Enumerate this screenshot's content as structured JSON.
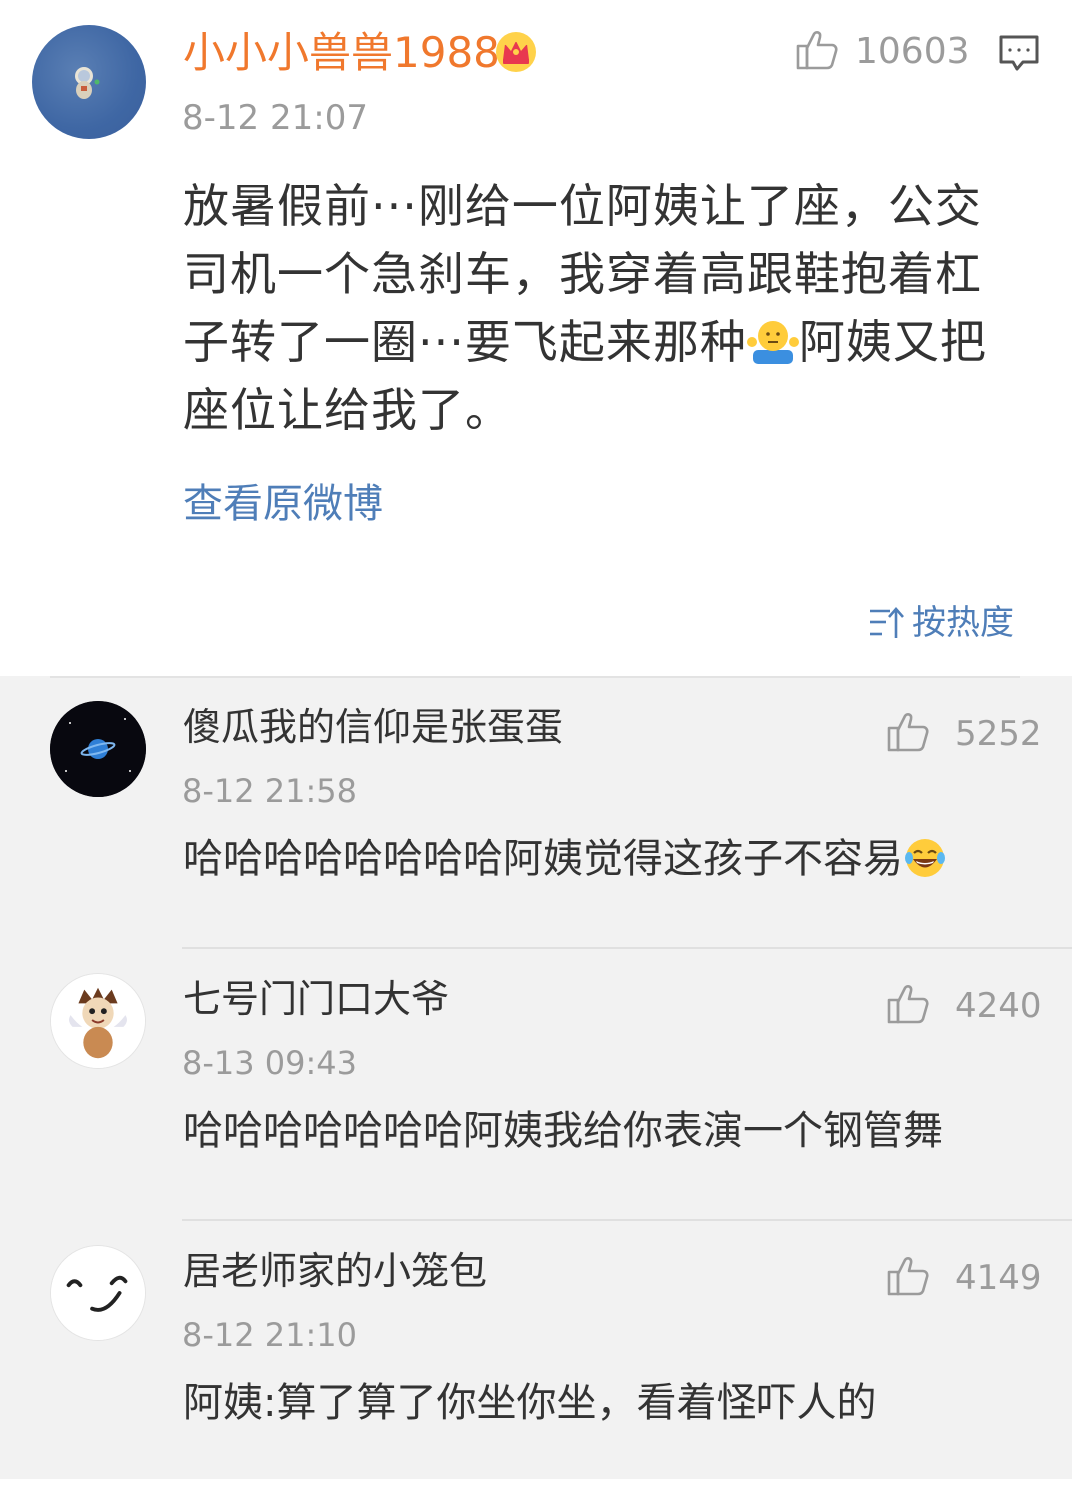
{
  "colors": {
    "username_orange": "#f0782d",
    "link_blue": "#4f7eb8",
    "meta_gray": "#9b9b9b",
    "body_text": "#333333",
    "replies_background": "#f2f2f2"
  },
  "main_comment": {
    "username": "小小小兽兽1988",
    "badge_icon": "crown-badge-icon",
    "time": "8-12 21:07",
    "like_count": "10603",
    "like_icon": "thumbs-up-icon",
    "comment_icon": "comment-bubble-icon",
    "text_before_emoji": "放暑假前···刚给一位阿姨让了座，公交司机一个急刹车，我穿着高跟鞋抱着杠子转了一圈···要飞起来那种",
    "emoji": "shrug-emoji-icon",
    "text_after_emoji": "阿姨又把座位让给我了。",
    "view_original_label": "查看原微博"
  },
  "sort": {
    "icon": "sort-icon",
    "label": "按热度"
  },
  "replies": [
    {
      "username": "傻瓜我的信仰是张蛋蛋",
      "time": "8-12 21:58",
      "like_count": "5252",
      "text": "哈哈哈哈哈哈哈哈阿姨觉得这孩子不容易",
      "emoji": "laughing-tears-emoji-icon",
      "avatar": "planet-avatar"
    },
    {
      "username": "七号门门口大爷",
      "time": "8-13 09:43",
      "like_count": "4240",
      "text": "哈哈哈哈哈哈哈阿姨我给你表演一个钢管舞",
      "avatar": "cartoon-cat-avatar"
    },
    {
      "username": "居老师家的小笼包",
      "time": "8-12 21:10",
      "like_count": "4149",
      "text": "阿姨:算了算了你坐你坐，看着怪吓人的",
      "avatar": "sketch-face-avatar"
    }
  ]
}
